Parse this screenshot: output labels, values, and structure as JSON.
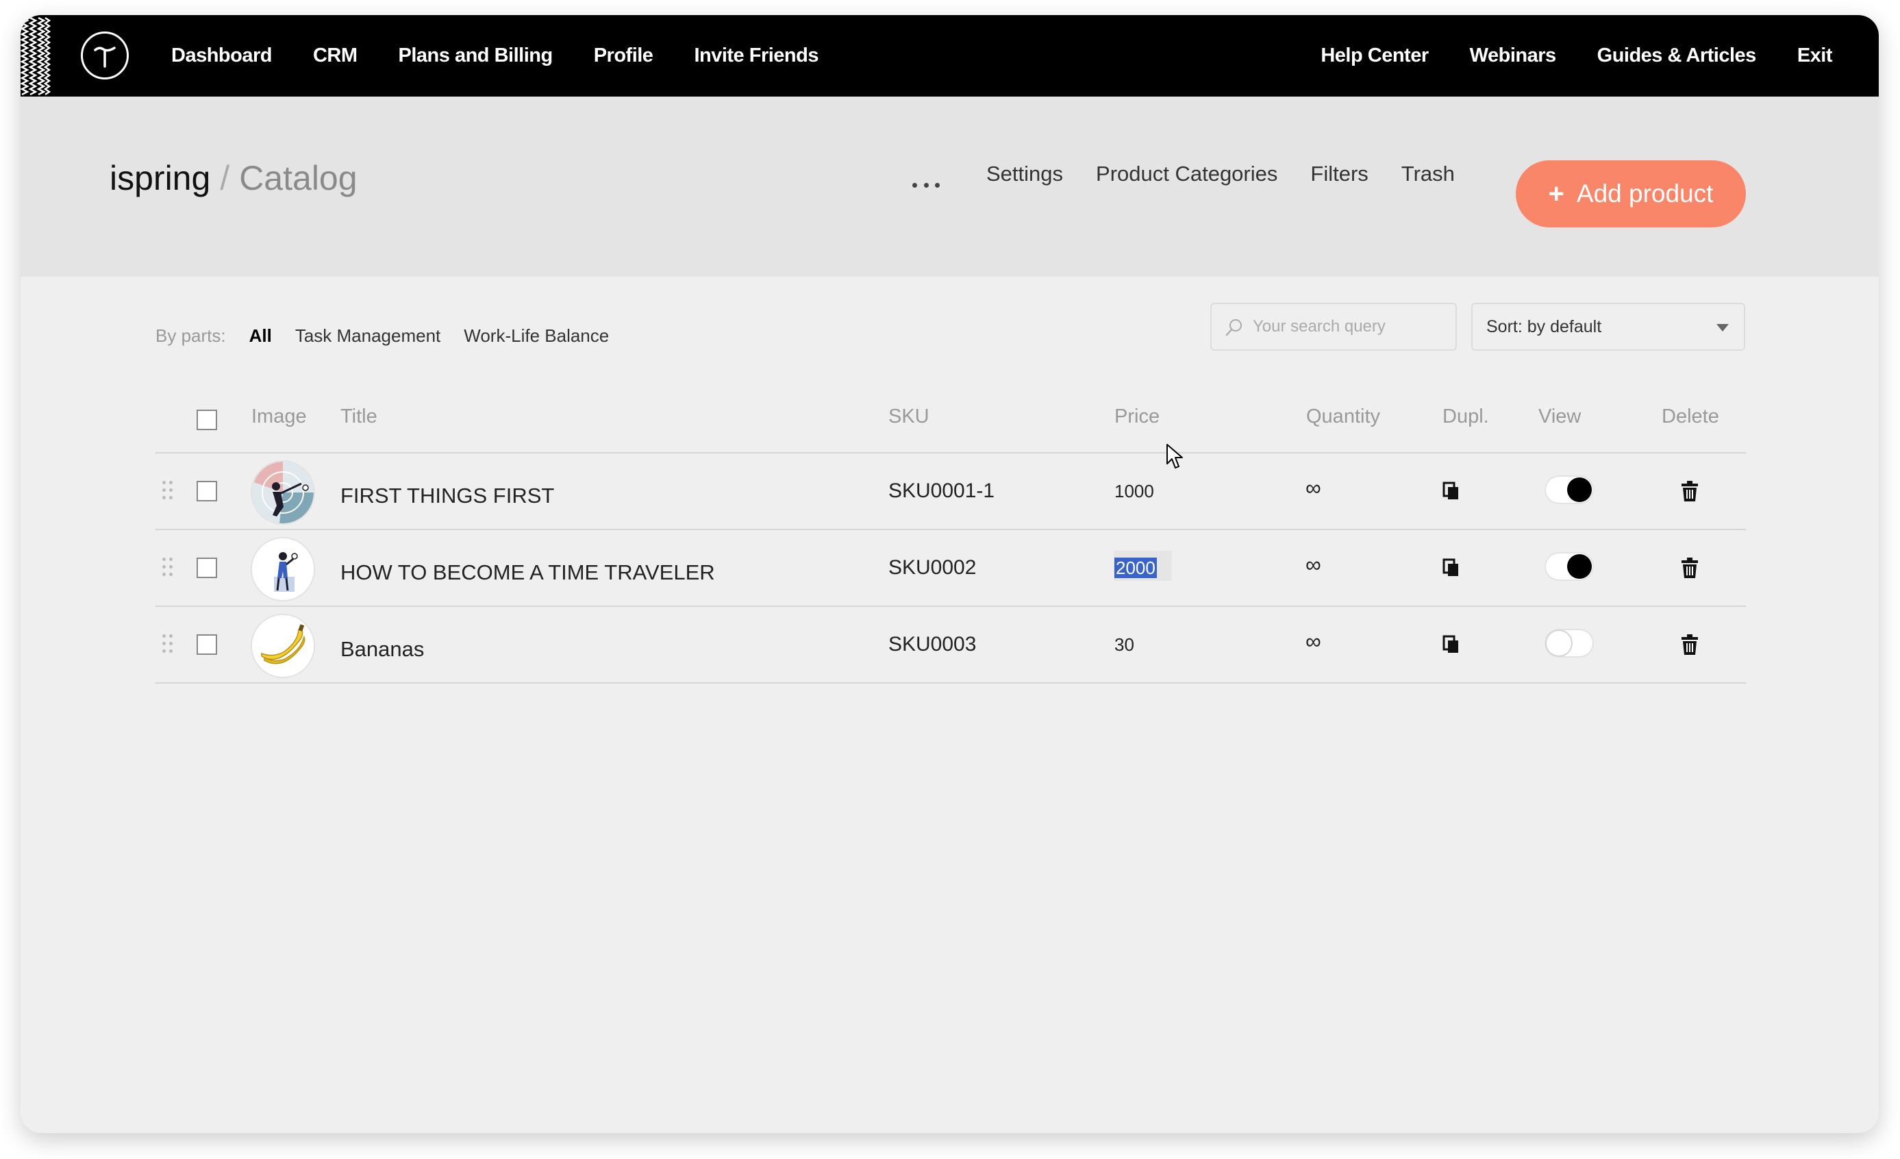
{
  "topbar": {
    "nav_left": [
      "Dashboard",
      "CRM",
      "Plans and Billing",
      "Profile",
      "Invite Friends"
    ],
    "nav_right": [
      "Help Center",
      "Webinars",
      "Guides & Articles",
      "Exit"
    ]
  },
  "header": {
    "project": "ispring",
    "separator": "/",
    "page": "Catalog",
    "links": [
      "Settings",
      "Product Categories",
      "Filters",
      "Trash"
    ],
    "add_button": "Add product",
    "add_button_icon": "+",
    "accent_color": "#fa8669"
  },
  "filters": {
    "label": "By parts:",
    "parts": [
      "All",
      "Task Management",
      "Work-Life Balance"
    ],
    "active_part": "All",
    "search_placeholder": "Your search query",
    "sort_value": "Sort: by default"
  },
  "table": {
    "headers": {
      "image": "Image",
      "title": "Title",
      "sku": "SKU",
      "price": "Price",
      "quantity": "Quantity",
      "dupl": "Dupl.",
      "view": "View",
      "delete": "Delete"
    },
    "rows": [
      {
        "title": "FIRST THINGS FIRST",
        "sku": "SKU0001-1",
        "price": "1000",
        "quantity": "∞",
        "visible": true,
        "image_icon": "archer-illustration-icon"
      },
      {
        "title": "HOW TO BECOME A TIME TRAVELER",
        "sku": "SKU0002",
        "price": "2000",
        "quantity": "∞",
        "visible": true,
        "price_selected": true,
        "image_icon": "time-traveler-illustration-icon"
      },
      {
        "title": "Bananas",
        "sku": "SKU0003",
        "price": "30",
        "quantity": "∞",
        "visible": false,
        "image_icon": "banana-icon"
      }
    ]
  }
}
